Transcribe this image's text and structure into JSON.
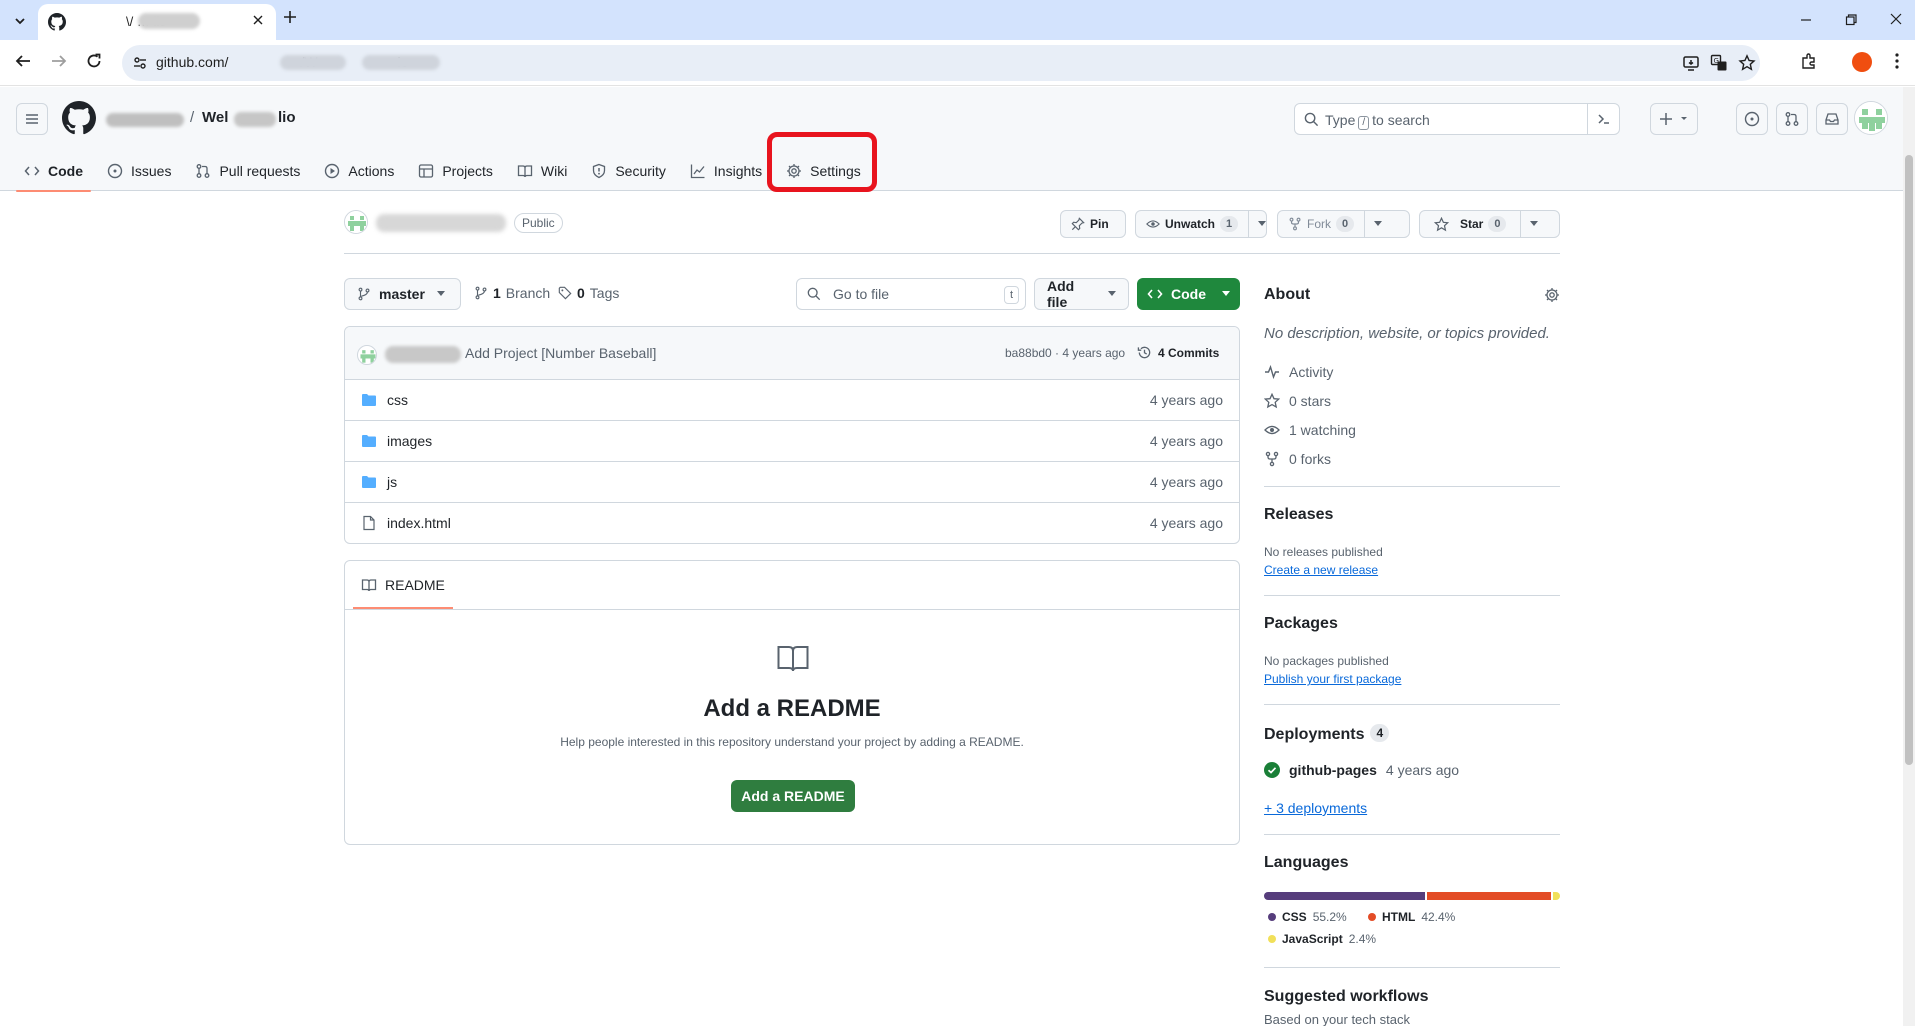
{
  "browser": {
    "tab_title": "\\/ … lio",
    "url_prefix": "github.com/",
    "url_mid": "/W",
    "url_suffix": "io"
  },
  "header": {
    "crumb_separator": "/",
    "repo_start": "Wel",
    "repo_end": "lio",
    "search_before": "Type",
    "search_key": "/",
    "search_after": "to search"
  },
  "repo_nav": [
    {
      "label": "Code",
      "icon": "code-icon"
    },
    {
      "label": "Issues",
      "icon": "issue-icon"
    },
    {
      "label": "Pull requests",
      "icon": "pull-request-icon"
    },
    {
      "label": "Actions",
      "icon": "play-icon"
    },
    {
      "label": "Projects",
      "icon": "table-icon"
    },
    {
      "label": "Wiki",
      "icon": "book-icon"
    },
    {
      "label": "Security",
      "icon": "shield-icon"
    },
    {
      "label": "Insights",
      "icon": "graph-icon"
    },
    {
      "label": "Settings",
      "icon": "gear-icon"
    }
  ],
  "repo_header": {
    "visibility": "Public",
    "pin": "Pin",
    "unwatch": "Unwatch",
    "unwatch_count": "1",
    "fork": "Fork",
    "fork_count": "0",
    "star": "Star",
    "star_count": "0"
  },
  "file_controls": {
    "branch": "master",
    "branches_count": "1",
    "branches_label": "Branch",
    "tags_count": "0",
    "tags_label": "Tags",
    "goto_placeholder": "Go to file",
    "goto_key": "t",
    "add_file": "Add file",
    "code": "Code"
  },
  "latest_commit": {
    "message": "Add Project [Number Baseball]",
    "sha_age": "ba88bd0 · 4 years ago",
    "commits": "4 Commits"
  },
  "files": [
    {
      "name": "css",
      "type": "folder",
      "age": "4 years ago"
    },
    {
      "name": "images",
      "type": "folder",
      "age": "4 years ago"
    },
    {
      "name": "js",
      "type": "folder",
      "age": "4 years ago"
    },
    {
      "name": "index.html",
      "type": "file",
      "age": "4 years ago"
    }
  ],
  "readme": {
    "tab": "README",
    "heading": "Add a README",
    "text": "Help people interested in this repository understand your project by adding a README.",
    "button": "Add a README"
  },
  "about": {
    "heading": "About",
    "description": "No description, website, or topics provided.",
    "activity": "Activity",
    "stars": "0 stars",
    "watching": "1 watching",
    "forks": "0 forks"
  },
  "releases": {
    "heading": "Releases",
    "empty": "No releases published",
    "link": "Create a new release"
  },
  "packages": {
    "heading": "Packages",
    "empty": "No packages published",
    "link": "Publish your first package"
  },
  "deployments": {
    "heading": "Deployments",
    "count": "4",
    "name": "github-pages",
    "age": "4 years ago",
    "more": "+ 3 deployments"
  },
  "languages": {
    "heading": "Languages",
    "items": [
      {
        "name": "CSS",
        "percent": "55.2%",
        "value": 55.2,
        "color": "#563d7c"
      },
      {
        "name": "HTML",
        "percent": "42.4%",
        "value": 42.4,
        "color": "#e34c26"
      },
      {
        "name": "JavaScript",
        "percent": "2.4%",
        "value": 2.4,
        "color": "#f1e05a"
      }
    ]
  },
  "workflows": {
    "heading": "Suggested workflows",
    "subtext": "Based on your tech stack"
  },
  "colors": {
    "accent_underline": "#fd8c73",
    "primary_button": "#1f883d",
    "highlight": "#e8141e",
    "link": "#0969da"
  }
}
